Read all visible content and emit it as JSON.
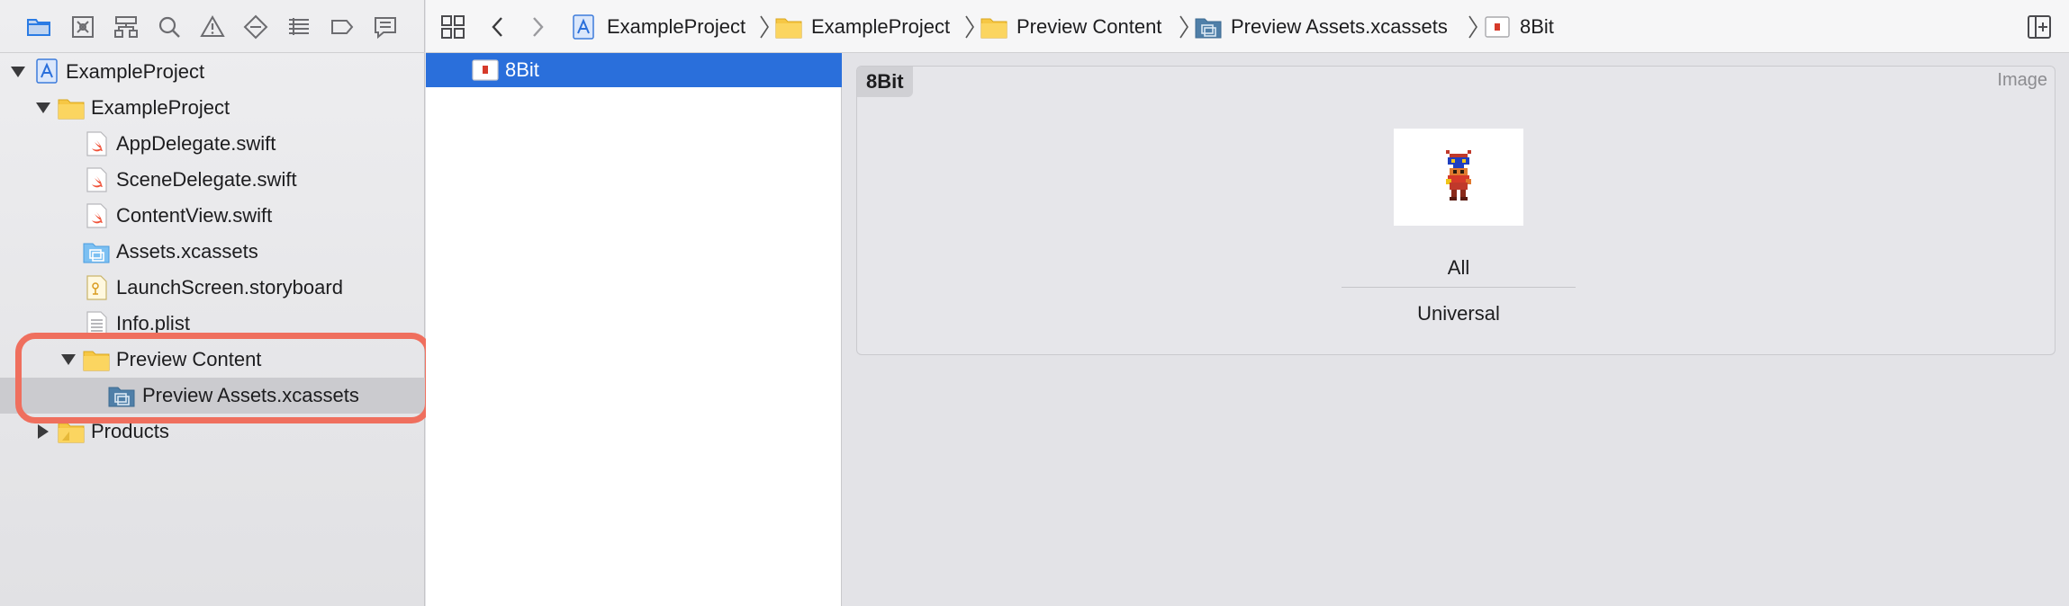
{
  "navigator": {
    "toolbar_icons": [
      "folder-icon",
      "source-control-icon",
      "hierarchy-icon",
      "search-icon",
      "warning-icon",
      "test-icon",
      "debug-icon",
      "breakpoint-icon",
      "report-icon"
    ],
    "items": [
      {
        "label": "ExampleProject",
        "icon": "project-icon",
        "expanded": true
      },
      {
        "label": "ExampleProject",
        "icon": "folder-icon",
        "expanded": true
      },
      {
        "label": "AppDelegate.swift",
        "icon": "swift-file-icon"
      },
      {
        "label": "SceneDelegate.swift",
        "icon": "swift-file-icon"
      },
      {
        "label": "ContentView.swift",
        "icon": "swift-file-icon"
      },
      {
        "label": "Assets.xcassets",
        "icon": "asset-catalog-icon"
      },
      {
        "label": "LaunchScreen.storyboard",
        "icon": "storyboard-icon"
      },
      {
        "label": "Info.plist",
        "icon": "plist-icon"
      },
      {
        "label": "Preview Content",
        "icon": "folder-icon",
        "expanded": true
      },
      {
        "label": "Preview Assets.xcassets",
        "icon": "asset-catalog-icon",
        "selected": true
      },
      {
        "label": "Products",
        "icon": "folder-icon",
        "expanded": false
      }
    ]
  },
  "jumpbar": {
    "breadcrumbs": [
      {
        "label": "ExampleProject",
        "icon": "project-icon"
      },
      {
        "label": "ExampleProject",
        "icon": "folder-icon"
      },
      {
        "label": "Preview Content",
        "icon": "folder-icon"
      },
      {
        "label": "Preview Assets.xcassets",
        "icon": "asset-catalog-icon"
      },
      {
        "label": "8Bit",
        "icon": "image-set-icon"
      }
    ]
  },
  "asset_list": {
    "items": [
      {
        "label": "8Bit",
        "selected": true
      }
    ]
  },
  "editor": {
    "set_name": "8Bit",
    "set_type": "Image",
    "slot_label": "All",
    "slot_sublabel": "Universal"
  },
  "colors": {
    "accent": "#2a6fdb",
    "highlight_outline": "#ef6f5e",
    "folder_yellow": "#f6c744",
    "swift_orange": "#f05138"
  }
}
